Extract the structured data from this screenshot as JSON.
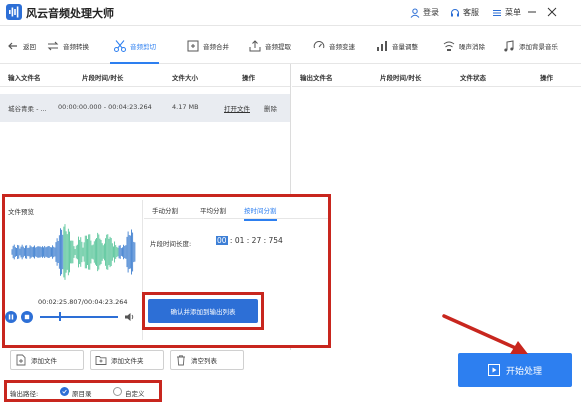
{
  "app": {
    "title": "风云音频处理大师"
  },
  "titlebar": {
    "login": "登录",
    "support": "客服",
    "menu": "菜单"
  },
  "toolbar": {
    "back": "返回",
    "items": [
      "音频转换",
      "音频剪切",
      "音频合并",
      "音频提取",
      "音频变速",
      "音量调整",
      "噪声消除",
      "添加背景音乐"
    ],
    "active_index": 1
  },
  "input_table": {
    "headers": [
      "输入文件名",
      "片段时间/时长",
      "文件大小",
      "操作"
    ],
    "rows": [
      {
        "name": "城谷青柔 - ...",
        "time": "00:00:00.000 - 00:04:23.264",
        "size": "4.17 MB",
        "open": "打开文件",
        "delete": "删除"
      }
    ]
  },
  "output_table": {
    "headers": [
      "输出文件名",
      "片段时间/时长",
      "文件状态",
      "操作"
    ]
  },
  "preview": {
    "title": "文件预览",
    "time_readout": "00:02:25.807/00:04:23.264",
    "seek_fraction": 0.24
  },
  "split": {
    "tabs": [
      "手动分割",
      "平均分割",
      "按时间分割"
    ],
    "active_tab": 2,
    "length_label": "片段时间长度:",
    "length_hh": "00",
    "length_rest": " : 01 : 27 : 754",
    "confirm": "确认并添加到输出列表"
  },
  "actions": {
    "add_file": "添加文件",
    "add_folder": "添加文件夹",
    "clear_list": "清空列表"
  },
  "output_path": {
    "label": "输出路径:",
    "source_dir": "原目录",
    "custom": "自定义",
    "selected": "source_dir"
  },
  "start": {
    "label": "开始处理"
  },
  "colors": {
    "accent": "#2d7ff0",
    "highlight_box": "#c8261e",
    "wave_blue": "#3f7fd0",
    "wave_green": "#58c59a"
  }
}
